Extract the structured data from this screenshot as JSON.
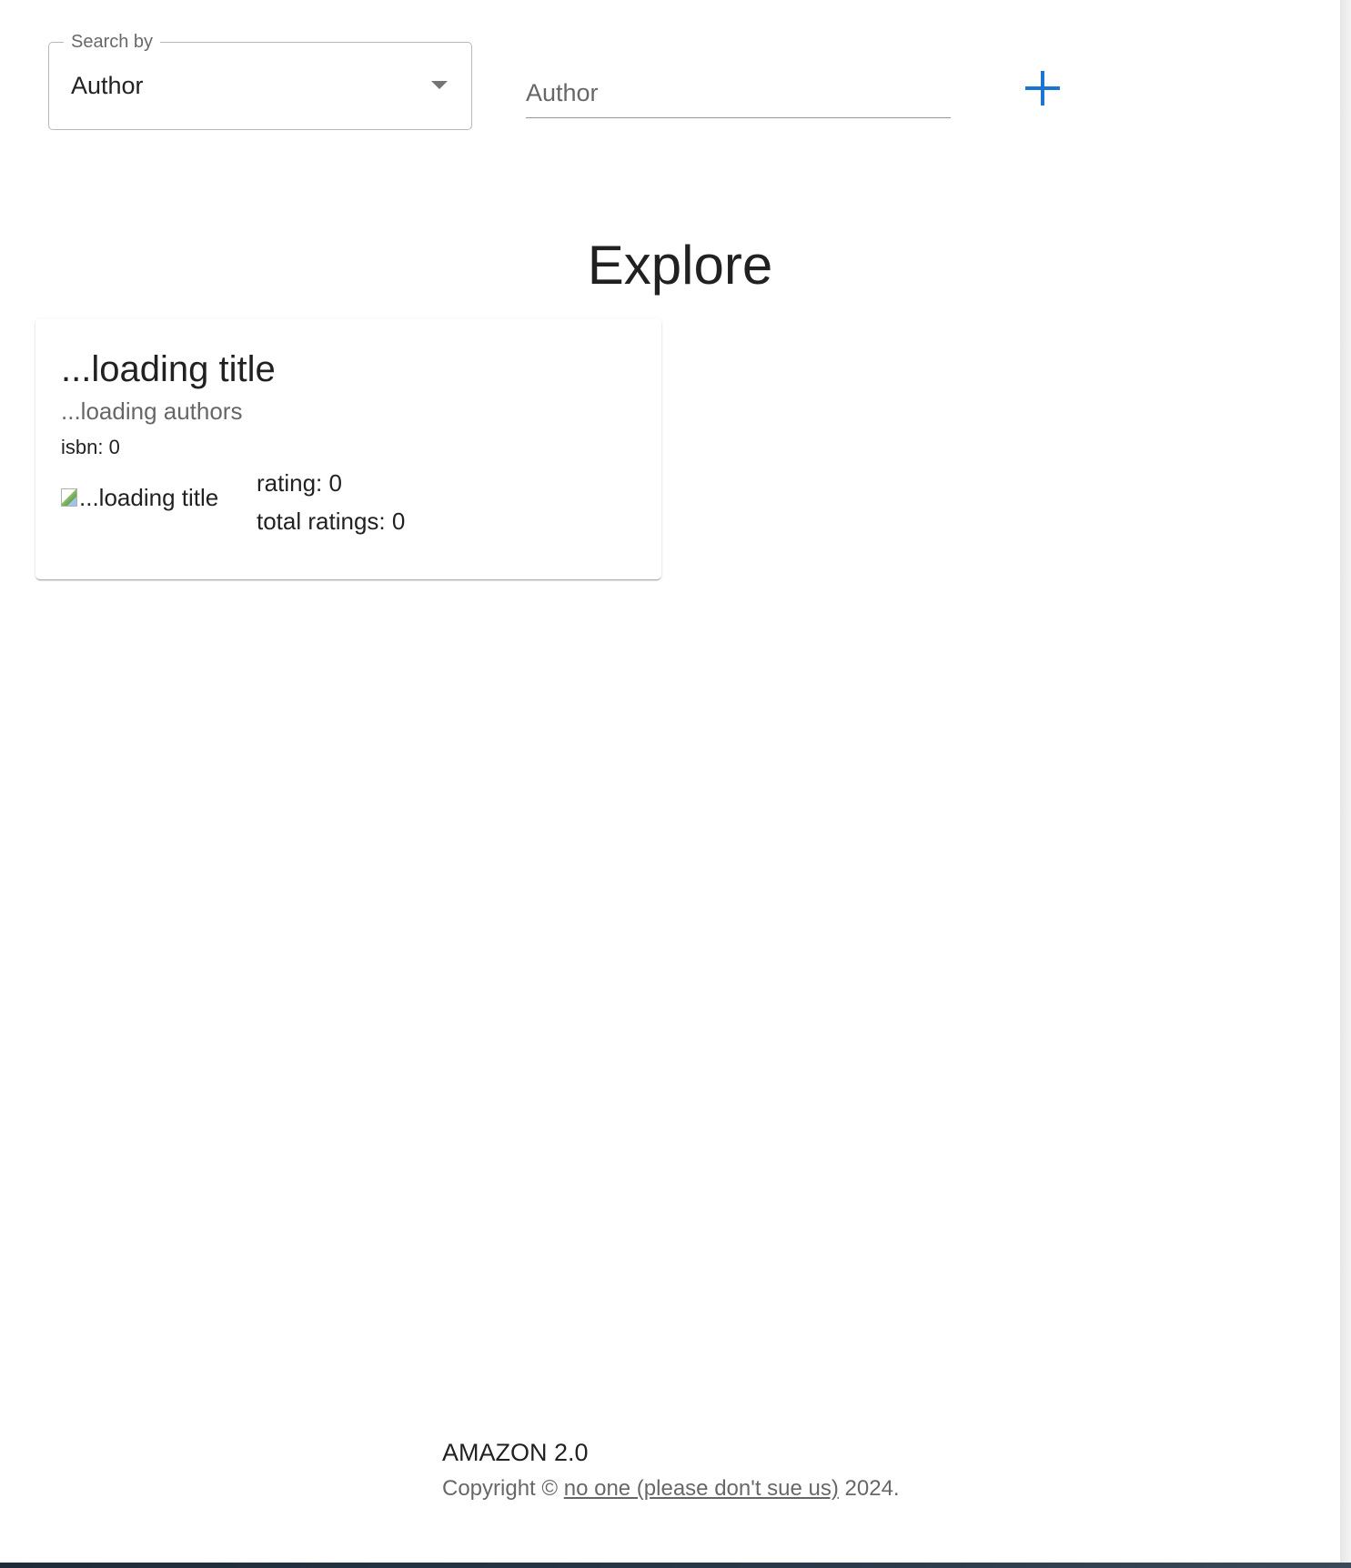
{
  "search": {
    "select_legend": "Search by",
    "select_value": "Author",
    "input_placeholder": "Author",
    "input_value": ""
  },
  "add_button": {
    "icon": "plus-icon",
    "color": "#1976d2"
  },
  "page": {
    "heading": "Explore"
  },
  "book_card": {
    "title": "...loading title",
    "authors": "...loading authors",
    "isbn_label": "isbn: ",
    "isbn_value": "0",
    "image_alt": "...loading title",
    "rating_label": "rating: ",
    "rating_value": "0",
    "total_ratings_label": "total ratings: ",
    "total_ratings_value": "0"
  },
  "footer": {
    "brand": "AMAZON 2.0",
    "copyright_prefix": "Copyright © ",
    "link_text": "no one (please don't sue us)",
    "copyright_suffix": " 2024."
  }
}
